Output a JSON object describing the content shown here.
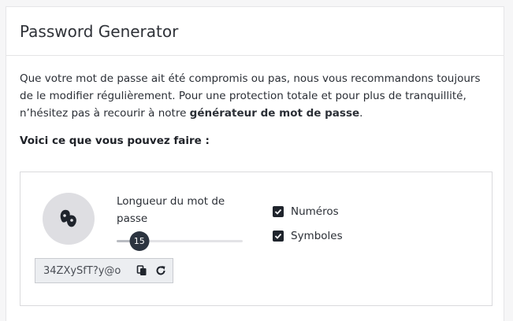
{
  "header": {
    "title": "Password Generator"
  },
  "intro": {
    "text_before": "Que votre mot de passe ait été compromis ou pas, nous vous recommandons toujours de le modifier régulièrement. Pour une protection totale et pour plus de tranquillité, n’hésitez pas à recourir à notre ",
    "bold": "générateur de mot de passe",
    "text_after": "."
  },
  "subtitle": "Voici ce que vous pouvez faire :",
  "generator": {
    "length_label": "Longueur du mot de passe",
    "length_value": "15",
    "length_fraction": 0.18,
    "password": "34ZXySfT?y@o",
    "options": [
      {
        "label": "Numéros",
        "checked": true
      },
      {
        "label": "Symboles",
        "checked": true
      }
    ]
  },
  "icons": {
    "avatar": "masked-user-icon",
    "copy": "copy-icon",
    "refresh": "refresh-icon",
    "check": "checkmark-icon"
  },
  "colors": {
    "thumb": "#2c3440",
    "checkbox": "#1f242c",
    "avatar_bg": "#dedee2"
  }
}
